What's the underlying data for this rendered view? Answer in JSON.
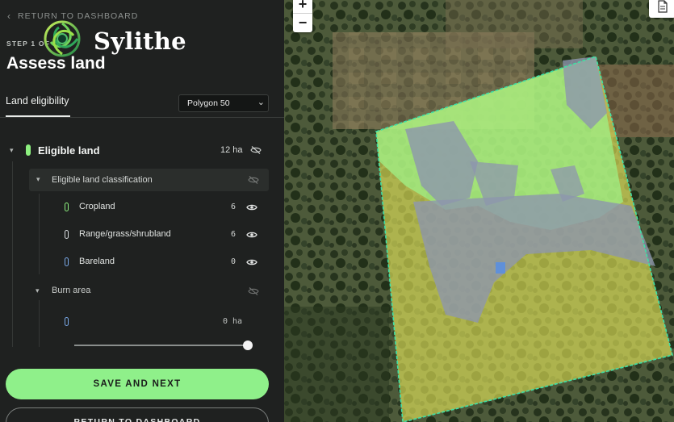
{
  "header": {
    "back_label": "RETURN TO DASHBOARD",
    "step_label": "STEP 1 OF",
    "brand": "Sylithe",
    "title": "Assess land"
  },
  "tabs": {
    "active_label": "Land eligibility",
    "polygon_select": {
      "selected": "Polygon 50"
    }
  },
  "eligible": {
    "label": "Eligible land",
    "value": "12 ha",
    "color": "#8df07f",
    "classification": {
      "label": "Eligible land classification",
      "items": [
        {
          "label": "Cropland",
          "value": "6",
          "color": "#8df07f"
        },
        {
          "label": "Range/grass/shrubland",
          "value": "6",
          "color": "#d9dde0"
        },
        {
          "label": "Bareland",
          "value": "0",
          "color": "#7aa9e8"
        }
      ]
    }
  },
  "burn": {
    "label": "Burn area",
    "value": "0 ha",
    "color": "#7aa9e8",
    "slider_fraction": 1.0
  },
  "buttons": {
    "save_next": "SAVE AND NEXT",
    "return": "RETURN TO DASHBOARD"
  },
  "map": {
    "zoom_in": "+",
    "zoom_out": "−",
    "polygon_outline_color": "#3fe0a4",
    "crop_color": "#9cf58a",
    "range_color": "#e9ea5b",
    "bare_color": "#8d96ad"
  }
}
